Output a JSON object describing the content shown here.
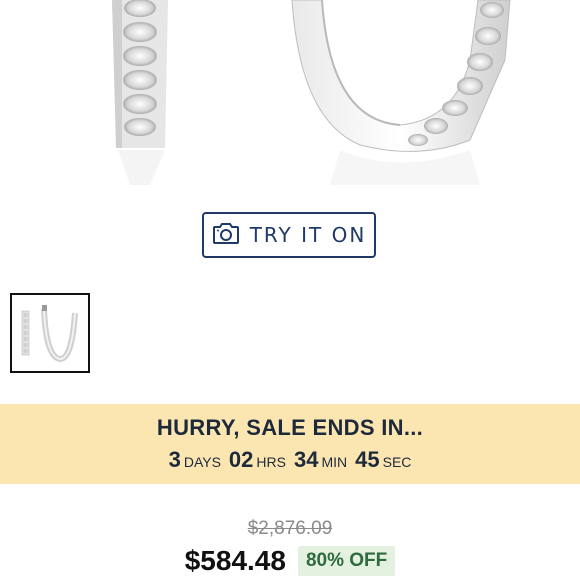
{
  "try_on": {
    "label": "TRY IT ON",
    "icon": "camera-icon"
  },
  "sale": {
    "title": "HURRY, SALE ENDS IN...",
    "countdown": [
      {
        "value": "3",
        "unit": "DAYS"
      },
      {
        "value": "02",
        "unit": "HRS"
      },
      {
        "value": "34",
        "unit": "MIN"
      },
      {
        "value": "45",
        "unit": "SEC"
      }
    ],
    "background_color": "#fbe6b2"
  },
  "pricing": {
    "original_price": "$2,876.09",
    "sale_price": "$584.48",
    "discount_badge": "80% OFF"
  }
}
